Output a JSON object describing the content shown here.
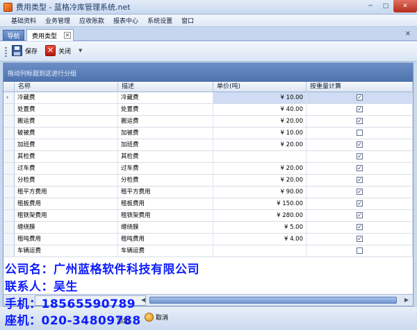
{
  "window": {
    "title": "费用类型 - 蓝格冷库管理系统.net"
  },
  "menu": [
    "基础资料",
    "业务管理",
    "应收账款",
    "报表中心",
    "系统设置",
    "窗口"
  ],
  "tabs": {
    "nav": "导航",
    "active": "费用类型",
    "close": "×"
  },
  "toolbar": {
    "save": "保存",
    "close": "关闭"
  },
  "grid": {
    "group_hint": "拖动列标题到这进行分组",
    "columns": [
      "名称",
      "描述",
      "单价(吨)",
      "按重量计算"
    ],
    "rows": [
      {
        "name": "冷藏费",
        "desc": "冷藏费",
        "price": "¥ 10.00",
        "checked": true
      },
      {
        "name": "处置费",
        "desc": "处置费",
        "price": "¥ 40.00",
        "checked": true
      },
      {
        "name": "搬运费",
        "desc": "搬运费",
        "price": "¥ 20.00",
        "checked": true
      },
      {
        "name": "破被费",
        "desc": "加被费",
        "price": "¥ 10.00",
        "checked": false
      },
      {
        "name": "加班费",
        "desc": "加班费",
        "price": "¥ 20.00",
        "checked": true
      },
      {
        "name": "其检费",
        "desc": "其检费",
        "price": "",
        "checked": true
      },
      {
        "name": "过车费",
        "desc": "过车费",
        "price": "¥ 20.00",
        "checked": true
      },
      {
        "name": "分检费",
        "desc": "分检费",
        "price": "¥ 20.00",
        "checked": true
      },
      {
        "name": "租平方费用",
        "desc": "租平方费用",
        "price": "¥ 90.00",
        "checked": true
      },
      {
        "name": "租板费用",
        "desc": "租板费用",
        "price": "¥ 150.00",
        "checked": true
      },
      {
        "name": "租铁架费用",
        "desc": "租铁架费用",
        "price": "¥ 280.00",
        "checked": true
      },
      {
        "name": "缠绕膜",
        "desc": "缠绕膜",
        "price": "¥ 5.00",
        "checked": true
      },
      {
        "name": "租吨费用",
        "desc": "租吨费用",
        "price": "¥ 4.00",
        "checked": true
      },
      {
        "name": "车辆运费",
        "desc": "车辆运费",
        "price": "",
        "checked": false
      }
    ]
  },
  "bottom": {
    "add": "添加",
    "cancel": "取消"
  },
  "watermark": {
    "company": "公司名：广州蓝格软件科技有限公司",
    "contact": "联系人：吴生",
    "mobile": "手机：18565590789",
    "phone": "座机：020-34809788"
  }
}
